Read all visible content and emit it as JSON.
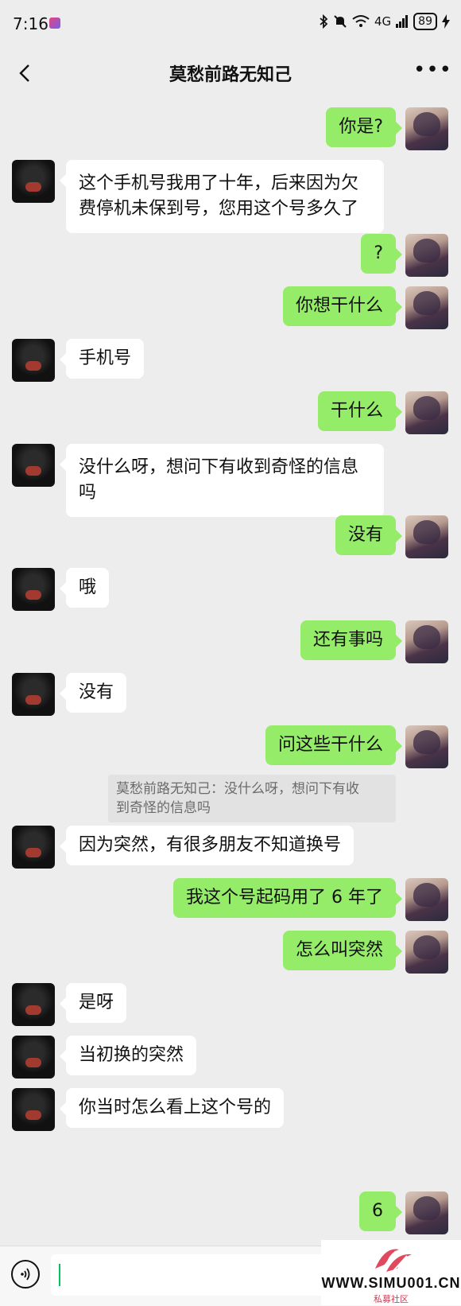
{
  "status_bar": {
    "time": "7:16",
    "network": "4G",
    "battery": "89"
  },
  "header": {
    "title": "莫愁前路无知己",
    "more_label": "•••"
  },
  "messages": [
    {
      "from": "me",
      "text": "你是?"
    },
    {
      "from": "them",
      "lines": [
        "这个手机号我用了十年，后来因为欠",
        "费停机未保到号，您用这个号多久了"
      ]
    },
    {
      "from": "me",
      "text": "?"
    },
    {
      "from": "me",
      "text": "你想干什么"
    },
    {
      "from": "them",
      "text": "手机号"
    },
    {
      "from": "me",
      "text": "干什么"
    },
    {
      "from": "them",
      "lines": [
        "没什么呀，想问下有收到奇怪的信息",
        "吗"
      ]
    },
    {
      "from": "me",
      "text": "没有"
    },
    {
      "from": "them",
      "text": "哦"
    },
    {
      "from": "me",
      "text": "还有事吗"
    },
    {
      "from": "them",
      "text": "没有"
    },
    {
      "from": "me",
      "text": "问这些干什么"
    },
    {
      "from": "them",
      "text": "因为突然，有很多朋友不知道换号"
    },
    {
      "from": "me",
      "text": "我这个号起码用了 6 年了"
    },
    {
      "from": "me",
      "text": "怎么叫突然"
    },
    {
      "from": "them",
      "text": "是呀"
    },
    {
      "from": "them",
      "text": "当初换的突然"
    },
    {
      "from": "them",
      "text": "你当时怎么看上这个号的"
    },
    {
      "from": "me",
      "text": "6"
    }
  ],
  "quote": {
    "lines": [
      "莫愁前路无知己：没什么呀，想问下有收",
      "到奇怪的信息吗"
    ]
  },
  "watermark": {
    "text": "WWW.SIMU001.CN",
    "subtext": "私募社区"
  },
  "colors": {
    "background": "#ededed",
    "my_bubble": "#95ec69",
    "their_bubble": "#ffffff"
  }
}
